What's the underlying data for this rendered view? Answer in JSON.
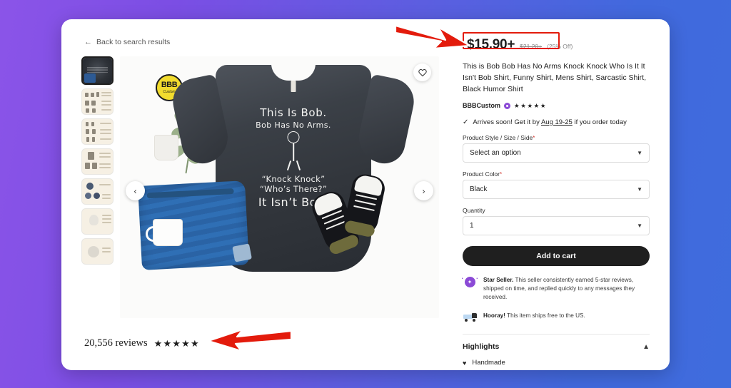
{
  "background": {
    "from": "#8b54e8",
    "to": "#4169dd"
  },
  "nav": {
    "back_label": "Back to search results",
    "back_icon": "arrow-left-icon"
  },
  "gallery": {
    "prev_icon": "chevron-left-icon",
    "next_icon": "chevron-right-icon",
    "favorite_icon": "heart-icon",
    "badge": {
      "title": "BBB",
      "subtitle": "Custom"
    },
    "print": {
      "line1": "This Is Bob.",
      "line2": "Bob Has No Arms.",
      "line3": "“Knock Knock”",
      "line4": "“Who’s There?”",
      "line5": "It Isn’t Bob."
    },
    "thumbnails": [
      {
        "name": "thumb-product-photo",
        "selected": true
      },
      {
        "name": "thumb-size-chart-1",
        "selected": false
      },
      {
        "name": "thumb-size-chart-2",
        "selected": false
      },
      {
        "name": "thumb-color-options",
        "selected": false
      },
      {
        "name": "thumb-swatches",
        "selected": false
      },
      {
        "name": "thumb-detail-1",
        "selected": false
      },
      {
        "name": "thumb-detail-2",
        "selected": false
      }
    ]
  },
  "reviews": {
    "count_label": "20,556 reviews",
    "stars": "★★★★★"
  },
  "product": {
    "price": "$15.90+",
    "old_price": "$21.20+",
    "discount": "(25% Off)",
    "title": "This is Bob Bob Has No Arms Knock Knock Who Is It It Isn't Bob Shirt, Funny Shirt, Mens Shirt, Sarcastic Shirt, Black Humor Shirt",
    "seller_name": "BBBCustom",
    "seller_stars": "★★★★★",
    "arrives_check": "✓",
    "arrives_pre": "Arrives soon! Get it by ",
    "arrives_date": "Aug 19-25",
    "arrives_post": " if you order today"
  },
  "form": {
    "style_label": "Product Style / Size / Side",
    "style_required": "*",
    "style_value": "Select an option",
    "color_label": "Product Color",
    "color_required": "*",
    "color_value": "Black",
    "quantity_label": "Quantity",
    "quantity_value": "1",
    "chevron_icon": "chevron-down-icon",
    "add_to_cart": "Add to cart"
  },
  "badges": {
    "star_seller_icon": "star-seal-icon",
    "star_seller_title": "Star Seller.",
    "star_seller_text": " This seller consistently earned 5-star reviews, shipped on time, and replied quickly to any messages they received.",
    "shipping_icon": "truck-icon",
    "shipping_title": "Hooray!",
    "shipping_text": " This item ships free to the US."
  },
  "highlights": {
    "heading": "Highlights",
    "collapse_icon": "chevron-up-icon",
    "items": [
      {
        "icon": "handmade-icon",
        "label": "Handmade"
      }
    ]
  },
  "annotations": {
    "highlight_color": "#e31b0c",
    "arrow_top_target": "price",
    "arrow_bottom_target": "reviews"
  }
}
